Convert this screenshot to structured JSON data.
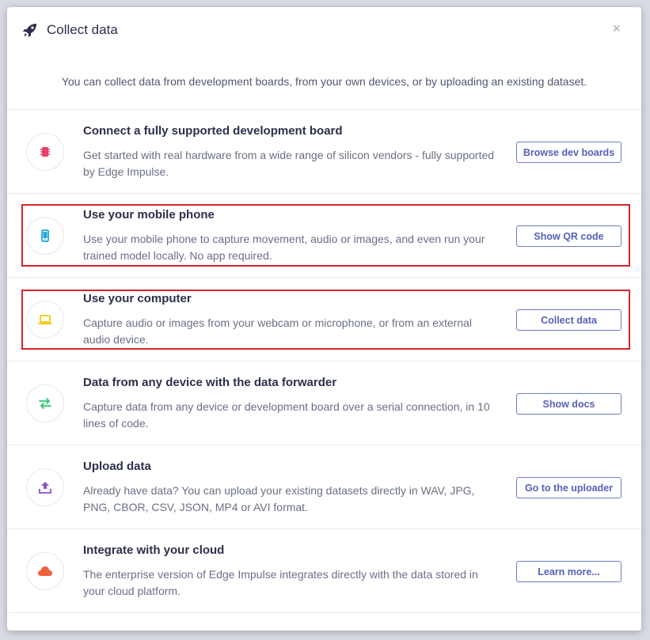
{
  "dialog": {
    "title": "Collect data",
    "close_glyph": "×",
    "intro": "You can collect data from development boards, from your own devices, or by uploading an existing dataset."
  },
  "options": [
    {
      "icon": "chip-icon",
      "icon_color": "#e83e6c",
      "title": "Connect a fully supported development board",
      "description": "Get started with real hardware from a wide range of silicon vendors - fully supported by Edge Impulse.",
      "button": "Browse dev boards"
    },
    {
      "icon": "mobile-phone-icon",
      "icon_color": "#1fa7d6",
      "title": "Use your mobile phone",
      "description": "Use your mobile phone to capture movement, audio or images, and even run your trained model locally. No app required.",
      "button": "Show QR code"
    },
    {
      "icon": "laptop-icon",
      "icon_color": "#f3c80b",
      "title": "Use your computer",
      "description": "Capture audio or images from your webcam or microphone, or from an external audio device.",
      "button": "Collect data"
    },
    {
      "icon": "exchange-arrows-icon",
      "icon_color": "#2fc46f",
      "title": "Data from any device with the data forwarder",
      "description": "Capture data from any device or development board over a serial connection, in 10 lines of code.",
      "button": "Show docs"
    },
    {
      "icon": "upload-icon",
      "icon_color": "#8a52c9",
      "title": "Upload data",
      "description": "Already have data? You can upload your existing datasets directly in WAV, JPG, PNG, CBOR, CSV, JSON, MP4 or AVI format.",
      "button": "Go to the uploader"
    },
    {
      "icon": "cloud-icon",
      "icon_color": "#f0603c",
      "title": "Integrate with your cloud",
      "description": "The enterprise version of Edge Impulse integrates directly with the data stored in your cloud platform.",
      "button": "Learn more..."
    }
  ],
  "colors": {
    "accent": "#5661b8",
    "highlight": "#d8232a",
    "title_text": "#2c2f4a"
  }
}
